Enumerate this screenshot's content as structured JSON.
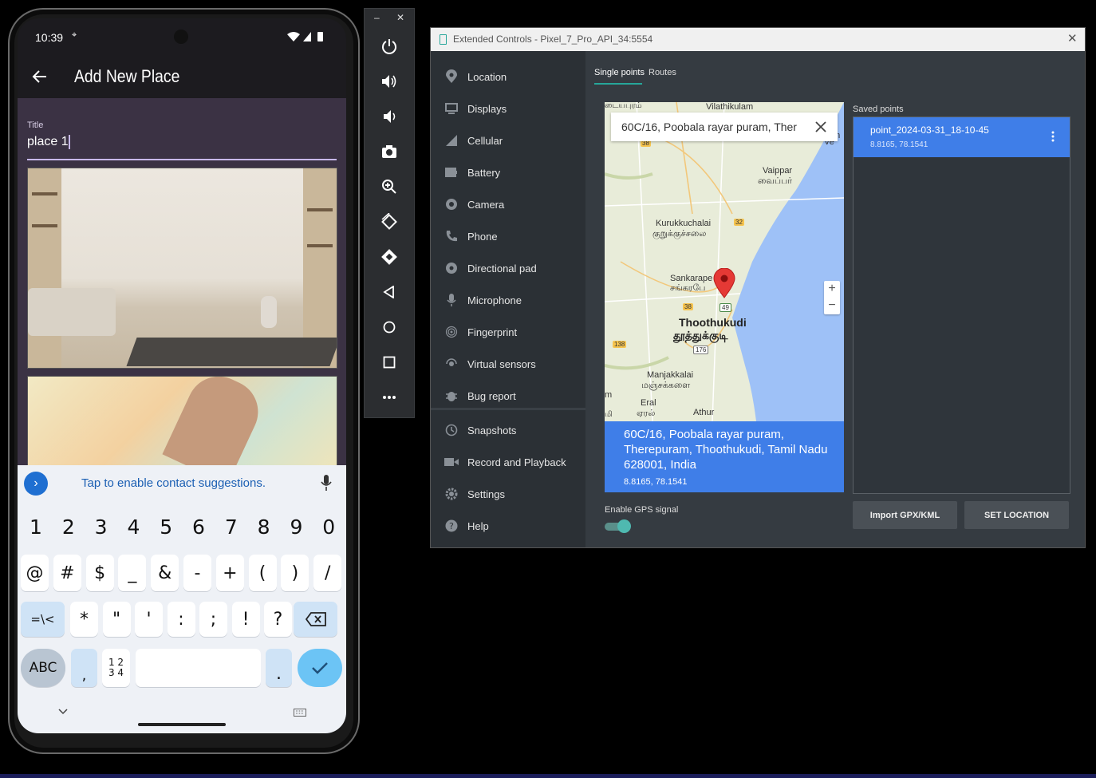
{
  "phone": {
    "status": {
      "time": "10:39"
    },
    "appbar": {
      "title": "Add New Place"
    },
    "form": {
      "title_label": "Title",
      "title_value": "place 1"
    },
    "keyboard": {
      "suggestion": "Tap to enable contact suggestions.",
      "row1": [
        "1",
        "2",
        "3",
        "4",
        "5",
        "6",
        "7",
        "8",
        "9",
        "0"
      ],
      "row2": [
        "@",
        "#",
        "$",
        "_",
        "&",
        "-",
        "+",
        "(",
        ")",
        "/"
      ],
      "row3": [
        "=\\<",
        "*",
        "\"",
        "'",
        ":",
        ";",
        "!",
        "?"
      ],
      "abc": "ABC",
      "comma": ",",
      "num_switch_top": "1 2",
      "num_switch_bottom": "3 4",
      "period": "."
    }
  },
  "extended_controls": {
    "window_title": "Extended Controls - Pixel_7_Pro_API_34:5554",
    "sidebar": [
      {
        "label": "Location",
        "icon": "location-pin-icon"
      },
      {
        "label": "Displays",
        "icon": "display-icon"
      },
      {
        "label": "Cellular",
        "icon": "cellular-icon"
      },
      {
        "label": "Battery",
        "icon": "battery-icon"
      },
      {
        "label": "Camera",
        "icon": "camera-aperture-icon"
      },
      {
        "label": "Phone",
        "icon": "phone-icon"
      },
      {
        "label": "Directional pad",
        "icon": "dpad-icon"
      },
      {
        "label": "Microphone",
        "icon": "microphone-icon"
      },
      {
        "label": "Fingerprint",
        "icon": "fingerprint-icon"
      },
      {
        "label": "Virtual sensors",
        "icon": "sensors-icon"
      },
      {
        "label": "Bug report",
        "icon": "bug-icon"
      },
      {
        "label": "Snapshots",
        "icon": "history-icon"
      },
      {
        "label": "Record and Playback",
        "icon": "video-icon"
      },
      {
        "label": "Settings",
        "icon": "gear-icon"
      },
      {
        "label": "Help",
        "icon": "help-icon"
      }
    ],
    "tabs": {
      "single": "Single points",
      "routes": "Routes"
    },
    "map": {
      "search_value": "60C/16, Poobala rayar puram, Ther",
      "labels": {
        "vilathikulam": "Vilathikulam",
        "top_left_tamil": "டையபுரம்",
        "vaippar": "Vaippar",
        "vaippar_ta": "வைப்பர்",
        "kurukkuchalai": "Kurukkuchalai",
        "kurukkuchalai_ta": "குறுக்குச்சலை",
        "sankarape": "Sankarape",
        "sankarape_ta": "சங்கரபே",
        "thoothukudi": "Thoothukudi",
        "thoothukudi_ta": "தூத்துக்குடி",
        "manjakkalai": "Manjakkalai",
        "manjakkalai_ta": "மஞ்சக்களை",
        "eral": "Eral",
        "eral_ta": "ஏரல்",
        "athur": "Athur",
        "r38a": "38",
        "r32": "32",
        "r38b": "38",
        "r49": "49",
        "r138": "138",
        "r176": "176",
        "edge_ve": "Ve",
        "edge_en": "en",
        "edge_m": "m",
        "edge_mi": "மி"
      },
      "zoom_in": "+",
      "zoom_out": "−",
      "info_address": "60C/16, Poobala rayar puram, Therepuram, Thoothukudi, Tamil Nadu 628001, India",
      "info_coords": "8.8165, 78.1541"
    },
    "gps_label": "Enable GPS signal",
    "gps_on": true,
    "saved": {
      "title": "Saved points",
      "items": [
        {
          "name": "point_2024-03-31_18-10-45",
          "coords": "8.8165, 78.1541"
        }
      ]
    },
    "buttons": {
      "import": "Import GPX/KML",
      "set": "SET LOCATION"
    }
  },
  "colors": {
    "accent": "#26a69a",
    "selected": "#3f7ee8",
    "map_water": "#9ec1f7",
    "map_land": "#e8ecd9"
  }
}
